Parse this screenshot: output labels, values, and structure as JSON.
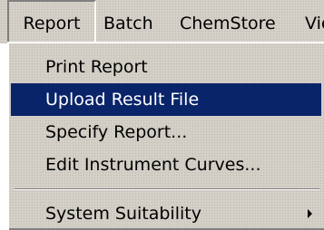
{
  "menubar": {
    "items": [
      {
        "label": "Report"
      },
      {
        "label": "Batch"
      },
      {
        "label": "ChemStore"
      },
      {
        "label": "Vie"
      }
    ]
  },
  "menu": {
    "items": [
      {
        "label": "Print Report"
      },
      {
        "label": "Upload Result File"
      },
      {
        "label": "Specify Report..."
      },
      {
        "label": "Edit Instrument Curves..."
      },
      {
        "label": "System Suitability"
      }
    ]
  },
  "icons": {
    "submenu": "chevron-right-icon"
  }
}
